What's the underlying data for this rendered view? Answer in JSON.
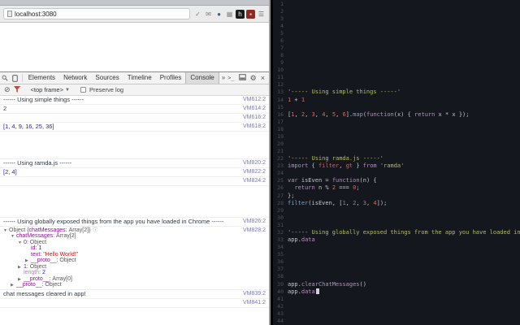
{
  "browser": {
    "url": "localhost:3080",
    "extension_icons": [
      {
        "name": "check-extension-icon",
        "glyph": "✓",
        "fg": "#7a7a7a",
        "bg": ""
      },
      {
        "name": "mail-extension-icon",
        "glyph": "✉",
        "fg": "#7a7a7a",
        "bg": ""
      },
      {
        "name": "circle-extension-icon",
        "glyph": "●",
        "fg": "#49606e",
        "bg": ""
      },
      {
        "name": "grid-extension-icon",
        "glyph": "▦",
        "fg": "#8a8a8a",
        "bg": ""
      },
      {
        "name": "h-extension-icon",
        "glyph": "h",
        "fg": "#ffffff",
        "bg": "#1a1a1a"
      },
      {
        "name": "red-square-extension-icon",
        "glyph": "▪",
        "fg": "#e8d5d5",
        "bg": "#8e2a23"
      },
      {
        "name": "menu-icon",
        "glyph": "☰",
        "fg": "#6a6a6a",
        "bg": ""
      }
    ]
  },
  "devtools": {
    "tabs": [
      "Elements",
      "Network",
      "Sources",
      "Timeline",
      "Profiles",
      "Console"
    ],
    "active_tab": "Console",
    "overflow_label": "»",
    "icons": {
      "drawer": ">_",
      "settings": "⚙",
      "close": "×",
      "clear": "⊘",
      "caret": "▼"
    },
    "console_toolbar": {
      "frame_selector": "<top frame>",
      "preserve_log_label": "Preserve log"
    },
    "console": {
      "entries": [
        {
          "type": "log",
          "text": "------ Using simple things ------",
          "cls": "plain",
          "source": "VM612:2"
        },
        {
          "type": "log",
          "text": "2",
          "cls": "number",
          "source": "VM614:2"
        },
        {
          "type": "log",
          "text": "",
          "cls": "plain",
          "source": "VM616:2"
        },
        {
          "type": "log",
          "text": "[1, 4, 9, 16, 25, 36]",
          "cls": "number",
          "source": "VM618:2"
        },
        {
          "type": "spacer",
          "h": 34
        },
        {
          "type": "log",
          "text": "------ Using ramda.js ------",
          "cls": "plain",
          "source": "VM820:2"
        },
        {
          "type": "log",
          "text": "[2, 4]",
          "cls": "number",
          "source": "VM822:2"
        },
        {
          "type": "log",
          "text": "",
          "cls": "plain",
          "source": "VM824:2"
        },
        {
          "type": "spacer",
          "h": 39
        },
        {
          "type": "log",
          "text": "------ Using globally exposed things from the app you have loaded in Chrome ------",
          "cls": "plain",
          "source": "VM826:2"
        },
        {
          "type": "tree",
          "source": "VM828:2",
          "rows": [
            {
              "indent": 0,
              "arrow": "▼",
              "info": true,
              "seg": [
                {
                  "t": "Object ",
                  "c": "obj"
                },
                {
                  "t": "{",
                  "c": "obj"
                },
                {
                  "t": "chatMessages",
                  "c": "key"
                },
                {
                  "t": ": ",
                  "c": "obj"
                },
                {
                  "t": "Array[2]",
                  "c": "obj"
                },
                {
                  "t": "}",
                  "c": "obj"
                }
              ]
            },
            {
              "indent": 1,
              "arrow": "▼",
              "seg": [
                {
                  "t": "chatMessages",
                  "c": "key"
                },
                {
                  "t": ": ",
                  "c": "obj"
                },
                {
                  "t": "Array[2]",
                  "c": "obj"
                }
              ]
            },
            {
              "indent": 2,
              "arrow": "▼",
              "seg": [
                {
                  "t": "0",
                  "c": "key"
                },
                {
                  "t": ": ",
                  "c": "obj"
                },
                {
                  "t": "Object",
                  "c": "obj"
                }
              ]
            },
            {
              "indent": 3,
              "arrow": "",
              "seg": [
                {
                  "t": "id",
                  "c": "key"
                },
                {
                  "t": ": ",
                  "c": "obj"
                },
                {
                  "t": "1",
                  "c": "num"
                }
              ]
            },
            {
              "indent": 3,
              "arrow": "",
              "seg": [
                {
                  "t": "text",
                  "c": "key"
                },
                {
                  "t": ": ",
                  "c": "obj"
                },
                {
                  "t": "\"Hello World!\"",
                  "c": "str"
                }
              ]
            },
            {
              "indent": 3,
              "arrow": "▶",
              "seg": [
                {
                  "t": "__proto__",
                  "c": "key"
                },
                {
                  "t": ": ",
                  "c": "obj"
                },
                {
                  "t": "Object",
                  "c": "obj"
                }
              ]
            },
            {
              "indent": 2,
              "arrow": "▶",
              "seg": [
                {
                  "t": "1",
                  "c": "key"
                },
                {
                  "t": ": ",
                  "c": "obj"
                },
                {
                  "t": "Object",
                  "c": "obj"
                }
              ]
            },
            {
              "indent": 2,
              "arrow": "",
              "seg": [
                {
                  "t": "length",
                  "c": "key-dim"
                },
                {
                  "t": ": ",
                  "c": "obj"
                },
                {
                  "t": "2",
                  "c": "num"
                }
              ]
            },
            {
              "indent": 2,
              "arrow": "▶",
              "seg": [
                {
                  "t": "__proto__",
                  "c": "key"
                },
                {
                  "t": ": ",
                  "c": "obj"
                },
                {
                  "t": "Array[0]",
                  "c": "obj"
                }
              ]
            },
            {
              "indent": 1,
              "arrow": "▶",
              "seg": [
                {
                  "t": "__proto__",
                  "c": "key"
                },
                {
                  "t": ": ",
                  "c": "obj"
                },
                {
                  "t": "Object",
                  "c": "obj"
                }
              ]
            }
          ]
        },
        {
          "type": "log",
          "text": "chat messages cleared in app!",
          "cls": "plain",
          "source": "VM839:2"
        },
        {
          "type": "log",
          "text": "",
          "cls": "plain",
          "source": "VM841:2"
        }
      ]
    }
  },
  "editor": {
    "line_count": 44,
    "cursor_line": 40,
    "lines": {
      "13": [
        {
          "t": "'----- Using simple things -----'",
          "c": "str"
        }
      ],
      "14": [
        {
          "t": "1",
          "c": "num"
        },
        {
          "t": " + ",
          "c": "fg"
        },
        {
          "t": "1",
          "c": "num"
        }
      ],
      "16": [
        {
          "t": "[",
          "c": "fg"
        },
        {
          "t": "1",
          "c": "num"
        },
        {
          "t": ", ",
          "c": "fg"
        },
        {
          "t": "2",
          "c": "num"
        },
        {
          "t": ", ",
          "c": "fg"
        },
        {
          "t": "3",
          "c": "num"
        },
        {
          "t": ", ",
          "c": "fg"
        },
        {
          "t": "4",
          "c": "num"
        },
        {
          "t": ", ",
          "c": "fg"
        },
        {
          "t": "5",
          "c": "num"
        },
        {
          "t": ", ",
          "c": "fg"
        },
        {
          "t": "6",
          "c": "num"
        },
        {
          "t": "].",
          "c": "fg"
        },
        {
          "t": "map",
          "c": "fn"
        },
        {
          "t": "(",
          "c": "fg"
        },
        {
          "t": "function",
          "c": "kw"
        },
        {
          "t": "(x) { ",
          "c": "fg"
        },
        {
          "t": "return",
          "c": "kw"
        },
        {
          "t": " x * x });",
          "c": "fg"
        }
      ],
      "22": [
        {
          "t": "'----- Using ramda.js -----'",
          "c": "str"
        }
      ],
      "23": [
        {
          "t": "import",
          "c": "kw"
        },
        {
          "t": " { ",
          "c": "fg"
        },
        {
          "t": "filter",
          "c": "red"
        },
        {
          "t": ", ",
          "c": "fg"
        },
        {
          "t": "gt",
          "c": "red"
        },
        {
          "t": " } ",
          "c": "fg"
        },
        {
          "t": "from",
          "c": "kw"
        },
        {
          "t": " ",
          "c": "fg"
        },
        {
          "t": "'ramda'",
          "c": "str"
        }
      ],
      "25": [
        {
          "t": "var",
          "c": "kw"
        },
        {
          "t": " isEven = ",
          "c": "fg"
        },
        {
          "t": "function",
          "c": "kw"
        },
        {
          "t": "(n) {",
          "c": "fg"
        }
      ],
      "26": [
        {
          "t": "  ",
          "c": "fg"
        },
        {
          "t": "return",
          "c": "kw"
        },
        {
          "t": " n % ",
          "c": "fg"
        },
        {
          "t": "2",
          "c": "num"
        },
        {
          "t": " === ",
          "c": "fg"
        },
        {
          "t": "0",
          "c": "num"
        },
        {
          "t": ";",
          "c": "fg"
        }
      ],
      "27": [
        {
          "t": "};",
          "c": "fg"
        }
      ],
      "28": [
        {
          "t": "filter",
          "c": "fn"
        },
        {
          "t": "(isEven, [",
          "c": "fg"
        },
        {
          "t": "1",
          "c": "num"
        },
        {
          "t": ", ",
          "c": "fg"
        },
        {
          "t": "2",
          "c": "num"
        },
        {
          "t": ", ",
          "c": "fg"
        },
        {
          "t": "3",
          "c": "num"
        },
        {
          "t": ", ",
          "c": "fg"
        },
        {
          "t": "4",
          "c": "num"
        },
        {
          "t": "]);",
          "c": "fg"
        }
      ],
      "32": [
        {
          "t": "'----- Using globally exposed things from the app you have loaded in Chrome -----'",
          "c": "str"
        }
      ],
      "33": [
        {
          "t": "app",
          "c": "fg"
        },
        {
          "t": ".",
          "c": "fg"
        },
        {
          "t": "data",
          "c": "prop"
        }
      ],
      "39": [
        {
          "t": "app",
          "c": "fg"
        },
        {
          "t": ".",
          "c": "fg"
        },
        {
          "t": "clearChatMessages",
          "c": "prop"
        },
        {
          "t": "()",
          "c": "fg"
        }
      ],
      "40": [
        {
          "t": "app",
          "c": "fg"
        },
        {
          "t": ".",
          "c": "fg"
        },
        {
          "t": "data",
          "c": "prop"
        }
      ]
    }
  }
}
